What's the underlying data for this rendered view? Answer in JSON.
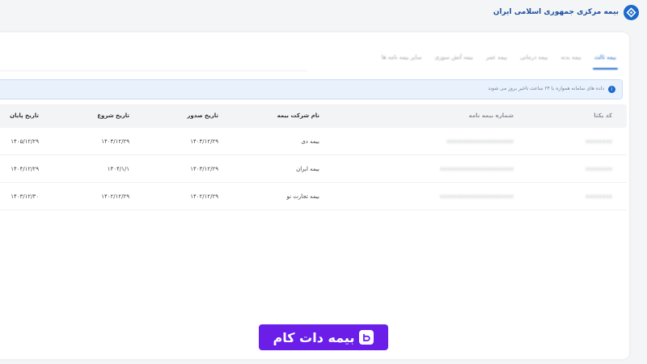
{
  "brand": {
    "title": "بیمه مرکزی جمهوری اسلامی ایران"
  },
  "tabs": [
    {
      "label": "بیمه ثالث",
      "active": true
    },
    {
      "label": "بیمه بدنه",
      "active": false
    },
    {
      "label": "بیمه درمانی",
      "active": false
    },
    {
      "label": "بیمه عمر",
      "active": false
    },
    {
      "label": "بیمه آتش سوزی",
      "active": false
    },
    {
      "label": "سایر بیمه نامه ها",
      "active": false
    }
  ],
  "alert": {
    "text": "داده های سامانه همواره با ۲۴ ساعت تاخیر بروز می شوند"
  },
  "table": {
    "headers": {
      "code": "کد یکتا",
      "policy_number": "شماره بیمه نامه",
      "company": "نام شرکت بیمه",
      "issue_date": "تاریخ صدور",
      "start_date": "تاریخ شروع",
      "end_date": "تاریخ پایان"
    },
    "rows": [
      {
        "code": "",
        "policy_number": "",
        "company": "بیمه دی",
        "issue_date": "۱۴۰۴/۱۲/۲۹",
        "start_date": "۱۴۰۴/۱۲/۲۹",
        "end_date": "۱۴۰۵/۱۲/۲۹"
      },
      {
        "code": "",
        "policy_number": "",
        "company": "بیمه ایران",
        "issue_date": "۱۴۰۳/۱۲/۲۹",
        "start_date": "۱۴۰۴/۱/۱",
        "end_date": "۱۴۰۴/۱۲/۲۹"
      },
      {
        "code": "",
        "policy_number": "",
        "company": "بیمه تجارت نو",
        "issue_date": "۱۴۰۲/۱۲/۲۹",
        "start_date": "۱۴۰۲/۱۲/۲۹",
        "end_date": "۱۴۰۳/۱۲/۳۰"
      }
    ]
  },
  "watermark": {
    "text": "بیمه دات کام"
  },
  "colors": {
    "accent": "#1c69c9",
    "watermark_bg": "#6b1ee8"
  }
}
